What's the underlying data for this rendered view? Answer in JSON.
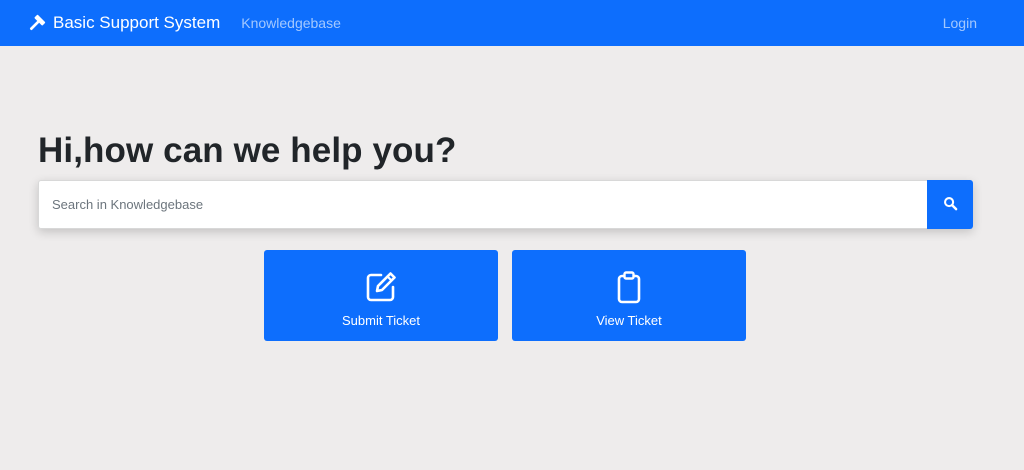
{
  "navbar": {
    "brand": "Basic Support System",
    "brand_icon": "hammer-icon",
    "links": [
      {
        "label": "Knowledgebase"
      }
    ],
    "login_label": "Login"
  },
  "hero": {
    "heading": "Hi,how can we help you?"
  },
  "search": {
    "placeholder": "Search in Knowledgebase",
    "value": "",
    "button_icon": "search-icon"
  },
  "actions": [
    {
      "label": "Submit Ticket",
      "icon": "edit-icon"
    },
    {
      "label": "View Ticket",
      "icon": "clipboard-icon"
    }
  ],
  "colors": {
    "primary": "#0d6efd",
    "background": "#eeecec",
    "heading_text": "#212529"
  }
}
